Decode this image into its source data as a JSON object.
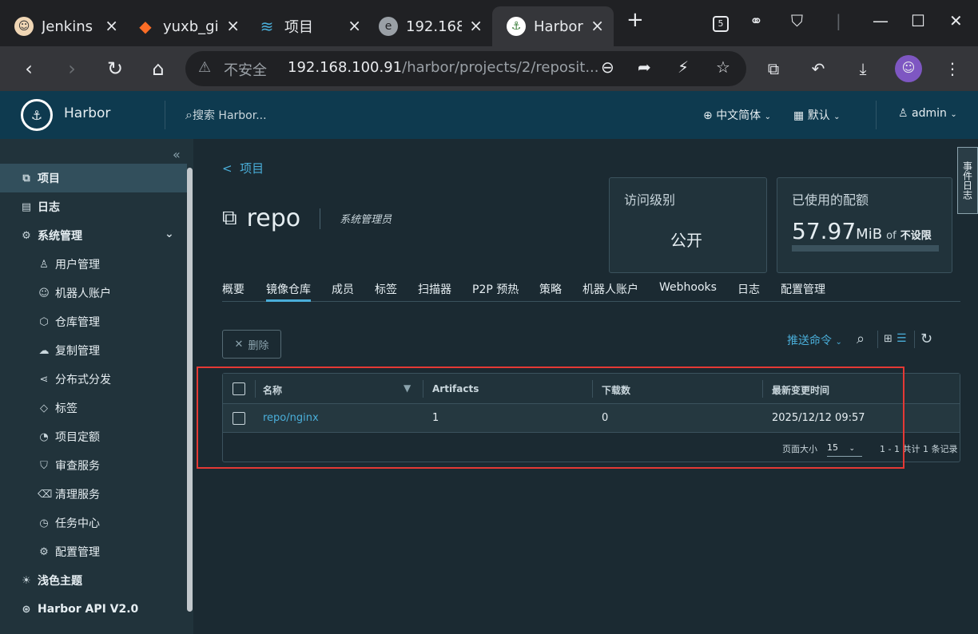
{
  "browser": {
    "tabs": [
      {
        "label": "Jenkins",
        "icon": "jenkins-icon"
      },
      {
        "label": "yuxb_gi",
        "icon": "gitlab-icon"
      },
      {
        "label": "项目",
        "icon": "harbor-wave-icon"
      },
      {
        "label": "192.168",
        "icon": "globe-icon"
      },
      {
        "label": "Harbor",
        "icon": "harbor-logo-icon",
        "active": true
      }
    ],
    "new_tab": "+",
    "tab_close": "×",
    "insecure_label": "不安全",
    "url_host": "192.168.100.91",
    "url_path": "/harbor/projects/2/reposit...",
    "window_badge": "5"
  },
  "header": {
    "brand": "Harbor",
    "search_placeholder": "搜索 Harbor...",
    "language": "中文简体",
    "date_format": "默认",
    "user": "admin"
  },
  "sidebar": {
    "items": [
      {
        "label": "项目",
        "icon": "project-icon",
        "level": "top",
        "active": true
      },
      {
        "label": "日志",
        "icon": "log-icon",
        "level": "top"
      },
      {
        "label": "系统管理",
        "icon": "admin-icon",
        "level": "top",
        "expanded": true
      },
      {
        "label": "用户管理",
        "icon": "users-icon",
        "level": "sub"
      },
      {
        "label": "机器人账户",
        "icon": "robot-icon",
        "level": "sub"
      },
      {
        "label": "仓库管理",
        "icon": "registry-icon",
        "level": "sub"
      },
      {
        "label": "复制管理",
        "icon": "replication-icon",
        "level": "sub"
      },
      {
        "label": "分布式分发",
        "icon": "share-icon",
        "level": "sub"
      },
      {
        "label": "标签",
        "icon": "tag-icon",
        "level": "sub"
      },
      {
        "label": "项目定额",
        "icon": "quota-icon",
        "level": "sub"
      },
      {
        "label": "审查服务",
        "icon": "shield-icon",
        "level": "sub"
      },
      {
        "label": "清理服务",
        "icon": "trash-icon",
        "level": "sub"
      },
      {
        "label": "任务中心",
        "icon": "clock-icon",
        "level": "sub"
      },
      {
        "label": "配置管理",
        "icon": "gear-icon",
        "level": "sub"
      },
      {
        "label": "浅色主题",
        "icon": "sun-icon",
        "level": "top"
      },
      {
        "label": "Harbor API V2.0",
        "icon": "api-icon",
        "level": "top"
      }
    ]
  },
  "project": {
    "back_label": "项目",
    "name": "repo",
    "role": "系统管理员",
    "access_card": {
      "title": "访问级别",
      "value": "公开"
    },
    "quota_card": {
      "title": "已使用的配额",
      "used": "57.97",
      "unit": "MiB",
      "of": "of",
      "limit": "不设限",
      "fill_fraction": 0.0
    }
  },
  "tabs": [
    "概要",
    "镜像仓库",
    "成员",
    "标签",
    "扫描器",
    "P2P 预热",
    "策略",
    "机器人账户",
    "Webhooks",
    "日志",
    "配置管理"
  ],
  "active_tab": "镜像仓库",
  "toolbar": {
    "delete_label": "删除",
    "push_command": "推送命令"
  },
  "grid": {
    "columns": [
      "名称",
      "Artifacts",
      "下载数",
      "最新变更时间"
    ],
    "rows": [
      {
        "name": "repo/nginx",
        "artifacts": "1",
        "pulls": "0",
        "updated": "2025/12/12 09:57"
      }
    ],
    "footer": {
      "page_size_label": "页面大小",
      "page_size": "15",
      "summary": "1 - 1 共计 1 条记录"
    }
  },
  "right_panel": {
    "label": "事件日志"
  },
  "colors": {
    "accent": "#4aaed9",
    "header": "#0e3a4f",
    "highlight": "#e53935"
  }
}
